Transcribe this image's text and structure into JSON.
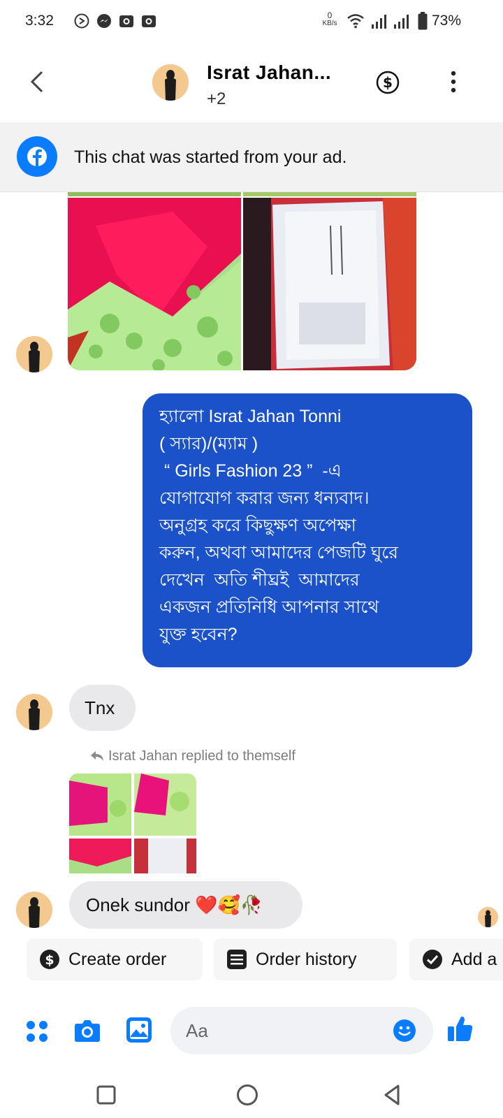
{
  "status_bar": {
    "time": "3:32",
    "net_speed_value": "0",
    "net_speed_unit": "KB/s",
    "battery": "73%",
    "notification_icons": [
      "android-auto-icon",
      "messenger-icon",
      "camera-icon",
      "camera-icon"
    ]
  },
  "header": {
    "back_icon": "chevron-left-icon",
    "title": "Israt Jahan...",
    "subtitle": "+2",
    "payment_icon": "dollar-circle-icon",
    "menu_icon": "more-vertical-icon"
  },
  "ad_banner": {
    "icon": "facebook-icon",
    "text": "This chat was started from your ad."
  },
  "messages": {
    "outgoing_lines": [
      "হ্যালো Israt Jahan Tonni",
      "( স্যার)/(ম্যাম )",
      " “ Girls Fashion 23 ”  -এ",
      "যোগাযোগ করার জন্য ধন্যবাদ।",
      "অনুগ্রহ করে কিছুক্ষণ অপেক্ষা",
      "করুন, অথবা আমাদের পেজটি ঘুরে",
      "দেখেন  অতি শীঘ্রই  আমাদের",
      "একজন প্রতিনিধি আপনার সাথে",
      "যুক্ত হবেন?"
    ],
    "incoming_1": "Tnx",
    "reply_note": "Israt Jahan replied to themself",
    "incoming_2": "Onek sundor ❤️🥰🥀"
  },
  "quick_actions": [
    {
      "label": "Create order",
      "icon": "dollar-circle-icon"
    },
    {
      "label": "Order history",
      "icon": "list-icon"
    },
    {
      "label": "Add a",
      "icon": "check-circle-icon"
    }
  ],
  "composer": {
    "placeholder": "Aa",
    "icons": [
      "apps-icon",
      "camera-icon",
      "gallery-icon",
      "emoji-icon",
      "like-icon"
    ]
  },
  "colors": {
    "accent": "#0a7cff",
    "outgoing_bubble": "#1b52c9",
    "incoming_bubble": "#e9e9eb"
  }
}
